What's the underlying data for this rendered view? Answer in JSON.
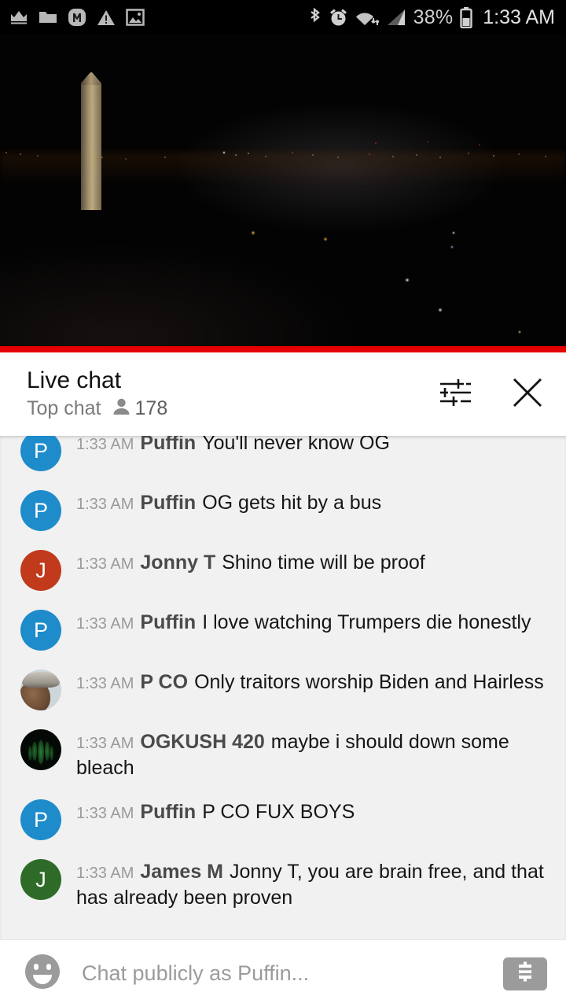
{
  "status_bar": {
    "left_icons": [
      "crown-icon",
      "folder-icon",
      "circled-m-icon",
      "warning-triangle-icon",
      "image-icon"
    ],
    "right_icons": [
      "bluetooth-icon",
      "alarm-clock-icon",
      "wifi-icon",
      "cell-signal-icon",
      "battery-icon"
    ],
    "battery_percent": "38%",
    "time": "1:33 AM"
  },
  "video": {
    "description": "Washington Monument night webcam",
    "progress_color": "#e60000",
    "progress_percent": 100,
    "track_color": "#e60000"
  },
  "chat_header": {
    "title": "Live chat",
    "subtitle": "Top chat",
    "viewer_count": "178",
    "settings_icon": "tune-sliders-icon",
    "close_icon": "close-x-icon"
  },
  "messages": [
    {
      "timestamp": "1:33 AM",
      "author": "Puffin",
      "text": "You'll never know OG",
      "avatar": {
        "type": "letter",
        "letter": "P",
        "color": "#1e8ccb"
      }
    },
    {
      "timestamp": "1:33 AM",
      "author": "Puffin",
      "text": "OG gets hit by a bus",
      "avatar": {
        "type": "letter",
        "letter": "P",
        "color": "#1e8ccb"
      }
    },
    {
      "timestamp": "1:33 AM",
      "author": "Jonny T",
      "text": "Shino time will be proof",
      "avatar": {
        "type": "letter",
        "letter": "J",
        "color": "#c03a1b"
      }
    },
    {
      "timestamp": "1:33 AM",
      "author": "Puffin",
      "text": "I love watching Trumpers die honestly",
      "avatar": {
        "type": "letter",
        "letter": "P",
        "color": "#1e8ccb"
      }
    },
    {
      "timestamp": "1:33 AM",
      "author": "P CO",
      "text": "Only traitors worship Biden and Hairless",
      "avatar": {
        "type": "photo-face",
        "letter": "",
        "color": "#cdd6d8"
      }
    },
    {
      "timestamp": "1:33 AM",
      "author": "OGKUSH 420",
      "text": "maybe i should down some bleach",
      "avatar": {
        "type": "photo-leaf",
        "letter": "",
        "color": "#050905"
      }
    },
    {
      "timestamp": "1:33 AM",
      "author": "Puffin",
      "text": "P CO FUX BOYS",
      "avatar": {
        "type": "letter",
        "letter": "P",
        "color": "#1e8ccb"
      }
    },
    {
      "timestamp": "1:33 AM",
      "author": "James M",
      "text": "Jonny T, you are brain free, and that has already been proven",
      "avatar": {
        "type": "letter",
        "letter": "J",
        "color": "#2f6b28"
      }
    }
  ],
  "input_bar": {
    "emoji_icon": "emoji-smiley-icon",
    "placeholder": "Chat publicly as Puffin...",
    "value": "",
    "superchat_icon": "dollar-sign-icon"
  }
}
